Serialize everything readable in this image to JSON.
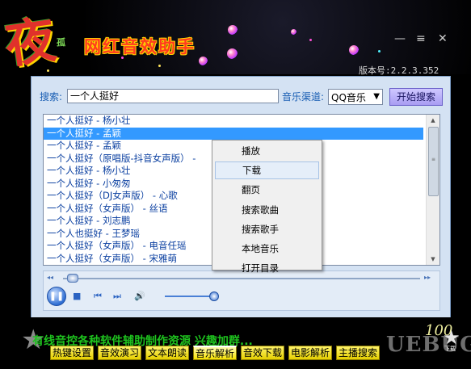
{
  "app": {
    "logo_char": "夜",
    "logo_small": "孤",
    "title": "网红音效助手",
    "version": "版本号:2.2.3.352",
    "minimize": "—",
    "menu": "≡",
    "close": "✕"
  },
  "search": {
    "label": "搜索:",
    "value": "一个人挺好",
    "source_label": "音乐渠道:",
    "source_value": "QQ音乐",
    "button": "开始搜索"
  },
  "songs": [
    "一个人挺好 - 杨小壮",
    "一个人挺好 - 孟颖",
    "一个人挺好 - 孟颖",
    "一个人挺好（原唱版-抖音女声版） -",
    "一个人挺好 - 杨小壮",
    "一个人挺好 - 小匆匆",
    "一个人挺好（DJ女声版） - 心歌",
    "一个人挺好（女声版） - 丝语",
    "一个人挺好 - 刘志鹏",
    "一个人也挺好 - 王梦瑶",
    "一个人挺好（女声版） - 电音任瑶",
    "一个人挺好（女声版） - 宋雅萌"
  ],
  "selected_index": 1,
  "context_menu": [
    "播放",
    "下载",
    "翻页",
    "搜索歌曲",
    "搜索歌手",
    "本地音乐",
    "打开目录"
  ],
  "context_hover_index": 1,
  "player": {
    "play_icon": "❚❚",
    "stop_icon": "■",
    "prev_icon": "⏮",
    "next_icon": "⏭",
    "volume_icon": "🔊",
    "progress_left": "◂◂",
    "progress_right": "▸▸",
    "progress": 0.02,
    "volume": 1.0
  },
  "bottom": {
    "marquee": "有线音控各种软件辅助制作资源 兴趣加群...",
    "counter": "100",
    "watermark": "UEBUG",
    "badge": "下载"
  },
  "tabs": [
    "热键设置",
    "音效演习",
    "文本朗读",
    "音乐解析",
    "音效下载",
    "电影解析",
    "主播搜索"
  ],
  "active_tab": 3,
  "colors": {
    "accent": "#3399ff",
    "title": "#ff3c1f",
    "panel": "#d4e2f3",
    "tab": "#f5e100"
  }
}
